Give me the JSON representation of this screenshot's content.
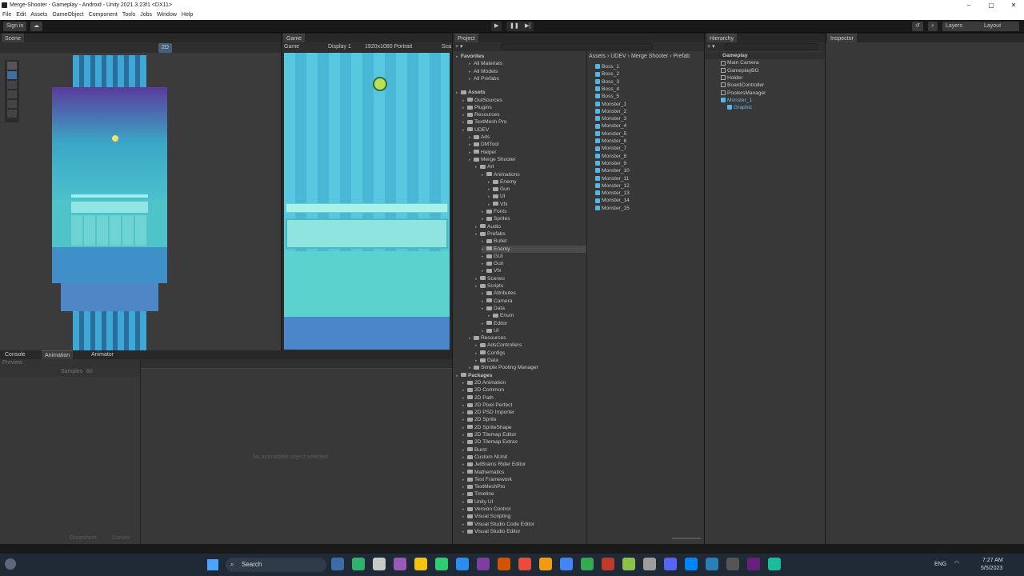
{
  "window": {
    "title": "Merge-Shooter - Gameplay - Android - Unity 2021.3.23f1 <DX11>"
  },
  "menu": [
    "File",
    "Edit",
    "Assets",
    "GameObject",
    "Component",
    "Tools",
    "Jobs",
    "Window",
    "Help"
  ],
  "toolbar": {
    "signin": "Sign in",
    "layers": "Layers",
    "layout": "Layout"
  },
  "tabs": {
    "scene": "Scene",
    "game": "Game",
    "project": "Project",
    "hierarchy": "Hierarchy",
    "inspector": "Inspector",
    "console": "Console",
    "animation": "Animation",
    "animator": "Animator"
  },
  "game": {
    "display": "Game",
    "display_sel": "Display 1",
    "resolution": "1920x1080 Portrait",
    "scale": "Sca"
  },
  "scene": {
    "mode": "2D"
  },
  "animation": {
    "preview": "Preview",
    "samples_label": "Samples",
    "samples": "60",
    "empty": "No animatable object selected.",
    "dopesheet": "Dopesheet",
    "curves": "Curves"
  },
  "project": {
    "favorites": "Favorites",
    "fav": [
      "All Materials",
      "All Models",
      "All Prefabs"
    ],
    "assets": "Assets",
    "tree": [
      {
        "l": "OutSources",
        "d": 1
      },
      {
        "l": "Plugins",
        "d": 1
      },
      {
        "l": "Resources",
        "d": 1
      },
      {
        "l": "TextMesh Pro",
        "d": 1
      },
      {
        "l": "UDEV",
        "d": 1
      },
      {
        "l": "Ads",
        "d": 2
      },
      {
        "l": "DMTool",
        "d": 2
      },
      {
        "l": "Helper",
        "d": 2
      },
      {
        "l": "Merge Shooter",
        "d": 2
      },
      {
        "l": "Art",
        "d": 3
      },
      {
        "l": "Animations",
        "d": 4
      },
      {
        "l": "Enemy",
        "d": 5
      },
      {
        "l": "Gun",
        "d": 5
      },
      {
        "l": "UI",
        "d": 5
      },
      {
        "l": "Vfx",
        "d": 5
      },
      {
        "l": "Fonts",
        "d": 4
      },
      {
        "l": "Sprites",
        "d": 4
      },
      {
        "l": "Audio",
        "d": 3
      },
      {
        "l": "Prefabs",
        "d": 3
      },
      {
        "l": "Bullet",
        "d": 4
      },
      {
        "l": "Enemy",
        "d": 4
      },
      {
        "l": "GUI",
        "d": 4
      },
      {
        "l": "Gun",
        "d": 4
      },
      {
        "l": "Vfx",
        "d": 4
      },
      {
        "l": "Scenes",
        "d": 3
      },
      {
        "l": "Scripts",
        "d": 3
      },
      {
        "l": "Attributes",
        "d": 4
      },
      {
        "l": "Camera",
        "d": 4
      },
      {
        "l": "Data",
        "d": 4
      },
      {
        "l": "Enum",
        "d": 5
      },
      {
        "l": "Editor",
        "d": 4
      },
      {
        "l": "UI",
        "d": 4
      },
      {
        "l": "Resources",
        "d": 2
      },
      {
        "l": "AdsControllers",
        "d": 3
      },
      {
        "l": "Configs",
        "d": 3
      },
      {
        "l": "Data",
        "d": 3
      },
      {
        "l": "Simple Pooling Manager",
        "d": 2
      }
    ],
    "packages": "Packages",
    "pkgs": [
      "2D Animation",
      "2D Common",
      "2D Path",
      "2D Pixel Perfect",
      "2D PSD Importer",
      "2D Sprite",
      "2D SpriteShape",
      "2D Tilemap Editor",
      "2D Tilemap Extras",
      "Burst",
      "Custom NUnit",
      "JetBrains Rider Editor",
      "Mathematics",
      "Test Framework",
      "TextMeshPro",
      "Timeline",
      "Unity UI",
      "Version Control",
      "Visual Scripting",
      "Visual Studio Code Editor",
      "Visual Studio Editor"
    ],
    "breadcrumb": [
      "Assets",
      "UDEV",
      "Merge Shooter",
      "Prefab"
    ],
    "files": [
      "Boss_1",
      "Boss_2",
      "Boss_3",
      "Boss_4",
      "Boss_5",
      "Monster_1",
      "Monster_2",
      "Monster_3",
      "Monster_4",
      "Monster_5",
      "Monster_6",
      "Monster_7",
      "Monster_8",
      "Monster_9",
      "Monster_10",
      "Monster_11",
      "Monster_12",
      "Monster_13",
      "Monster_14",
      "Monster_15"
    ]
  },
  "hierarchy": {
    "scene": "Gameplay",
    "items": [
      {
        "l": "Main Camera",
        "d": 1
      },
      {
        "l": "GameplayBG",
        "d": 1
      },
      {
        "l": "Holder",
        "d": 1
      },
      {
        "l": "BoardController",
        "d": 1
      },
      {
        "l": "PoolersManager",
        "d": 1
      },
      {
        "l": "Monster_1",
        "d": 1,
        "prefab": true
      },
      {
        "l": "Graphic",
        "d": 2,
        "prefab": true
      }
    ]
  },
  "taskbar": {
    "search": "Search",
    "lang": "ENG",
    "time": "7:27 AM",
    "date": "5/5/2023",
    "badge": "99+"
  },
  "colors": {
    "accent": "#4a90d9",
    "selection": "#2c5d87",
    "prefab": "#55b6e6"
  }
}
